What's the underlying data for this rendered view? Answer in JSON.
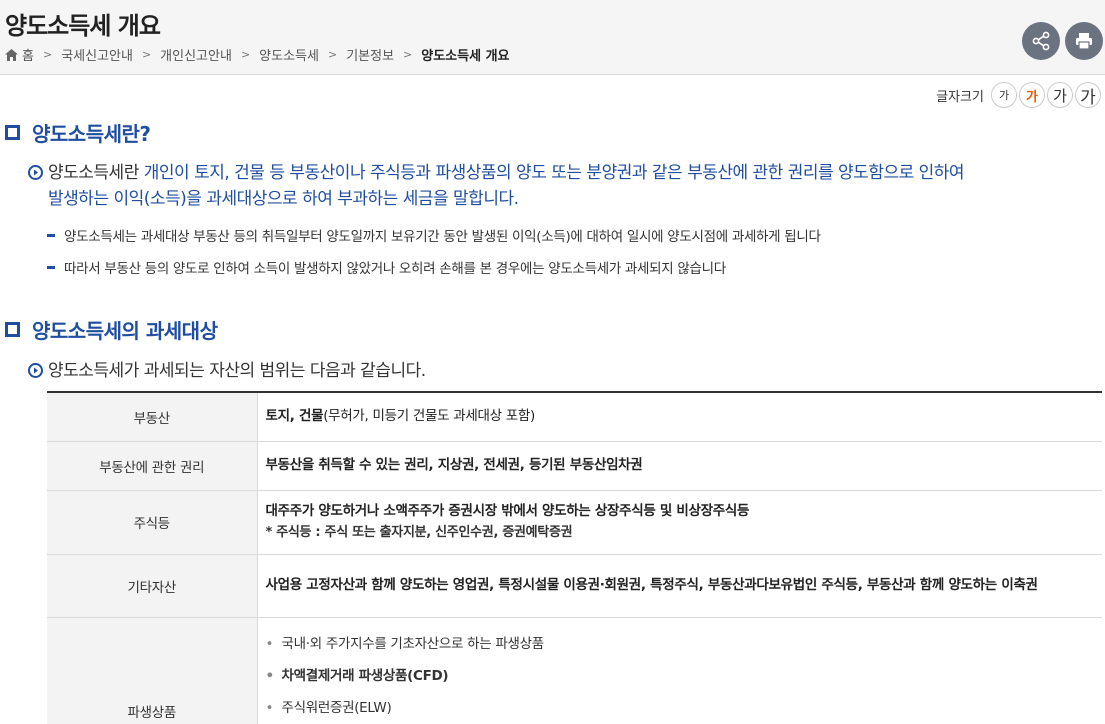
{
  "header": {
    "title": "양도소득세 개요",
    "breadcrumb": [
      "홈",
      "국세신고안내",
      "개인신고안내",
      "양도소득세",
      "기본정보",
      "양도소득세 개요"
    ]
  },
  "font_size": {
    "label": "글자크기",
    "options": [
      "가",
      "가",
      "가",
      "가"
    ],
    "active_color": "#e55b00"
  },
  "section1": {
    "title": "양도소득세란?",
    "lead_part1": "양도소득세란 ",
    "lead_part2": "개인이 토지, 건물 등 부동산이나 주식등과 파생상품의 양도 또는 분양권과 같은 부동산에 관한 권리를 양도함으로 인하여",
    "lead_part3": "발생하는 이익(소득)을 과세대상으로 하여 부과하는 세금을 말합니다.",
    "points": [
      "양도소득세는 과세대상 부동산 등의 취득일부터 양도일까지 보유기간 동안 발생된 이익(소득)에 대하여 일시에 양도시점에 과세하게 됩니다",
      "따라서 부동산 등의 양도로 인하여 소득이 발생하지 않았거나 오히려 손해를 본 경우에는 양도소득세가 과세되지 않습니다"
    ]
  },
  "section2": {
    "title": "양도소득세의 과세대상",
    "lead": "양도소득세가 과세되는 자산의 범위는 다음과 같습니다."
  },
  "table": {
    "rows": [
      {
        "label": "부동산",
        "bold": "토지, 건물",
        "normal": "(무허가, 미등기 건물도 과세대상 포함)"
      },
      {
        "label": "부동산에 관한 권리",
        "bold": "부동산을 취득할 수 있는 권리, 지상권, 전세권, 등기된 부동산임차권"
      },
      {
        "label": "주식등",
        "bold": "대주주가 양도하거나 소액주주가 증권시장 밖에서 양도하는 상장주식등 및 비상장주식등",
        "note": "* 주식등 : 주식 또는 출자지분, 신주인수권, 증권예탁증권"
      },
      {
        "label": "기타자산",
        "bold": "사업용 고정자산과 함께 양도하는 영업권, 특정시설물 이용권·회원권, 특정주식, 부동산과다보유법인 주식등, 부동산과 함께 양도하는 이축권"
      },
      {
        "label": "파생상품",
        "items": [
          "국내·외 주가지수를 기초자산으로 하는 파생상품",
          "차액결제거래 파생상품(CFD)",
          "주식워런증권(ELW)"
        ]
      }
    ]
  },
  "colors": {
    "accent_blue": "#1f4ea1",
    "header_bg": "#f5f5f5",
    "button_gray": "#6b7280"
  }
}
